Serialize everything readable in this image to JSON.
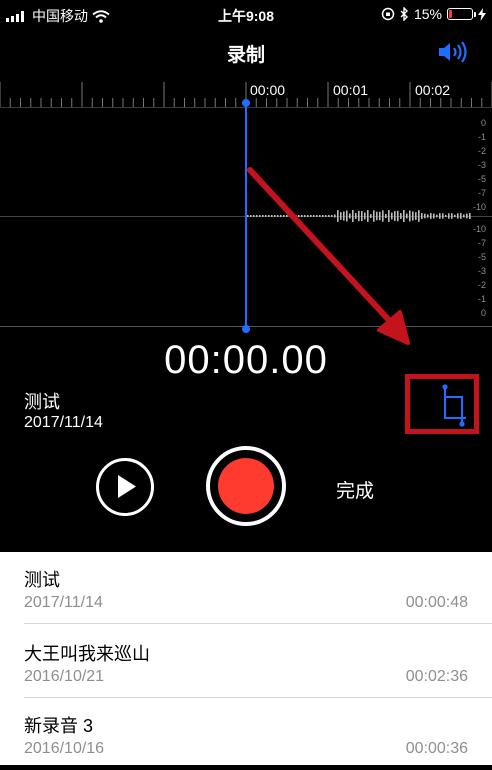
{
  "status_bar": {
    "carrier": "中国移动",
    "time": "上午9:08",
    "battery_percent": "15%",
    "battery_level": 0.15,
    "battery_color": "#ff3b30"
  },
  "nav": {
    "title": "录制"
  },
  "timeline": {
    "time_labels": [
      "00:00",
      "00:01",
      "00:02"
    ],
    "db_labels_top": [
      "0",
      "-1",
      "-2",
      "-3",
      "-5",
      "-7",
      "-10"
    ],
    "db_labels_bottom": [
      "-10",
      "-7",
      "-5",
      "-3",
      "-2",
      "-1",
      "0"
    ]
  },
  "recording": {
    "timer": "00:00.00",
    "title": "测试",
    "date": "2017/11/14"
  },
  "controls": {
    "done_label": "完成"
  },
  "recordings": [
    {
      "title": "测试",
      "date": "2017/11/14",
      "duration": "00:00:48"
    },
    {
      "title": "大王叫我来巡山",
      "date": "2016/10/21",
      "duration": "00:02:36"
    },
    {
      "title": "新录音 3",
      "date": "2016/10/16",
      "duration": "00:00:36"
    }
  ],
  "colors": {
    "accent": "#1e6fff",
    "record": "#ff3b30",
    "annotation": "#c3141d"
  }
}
